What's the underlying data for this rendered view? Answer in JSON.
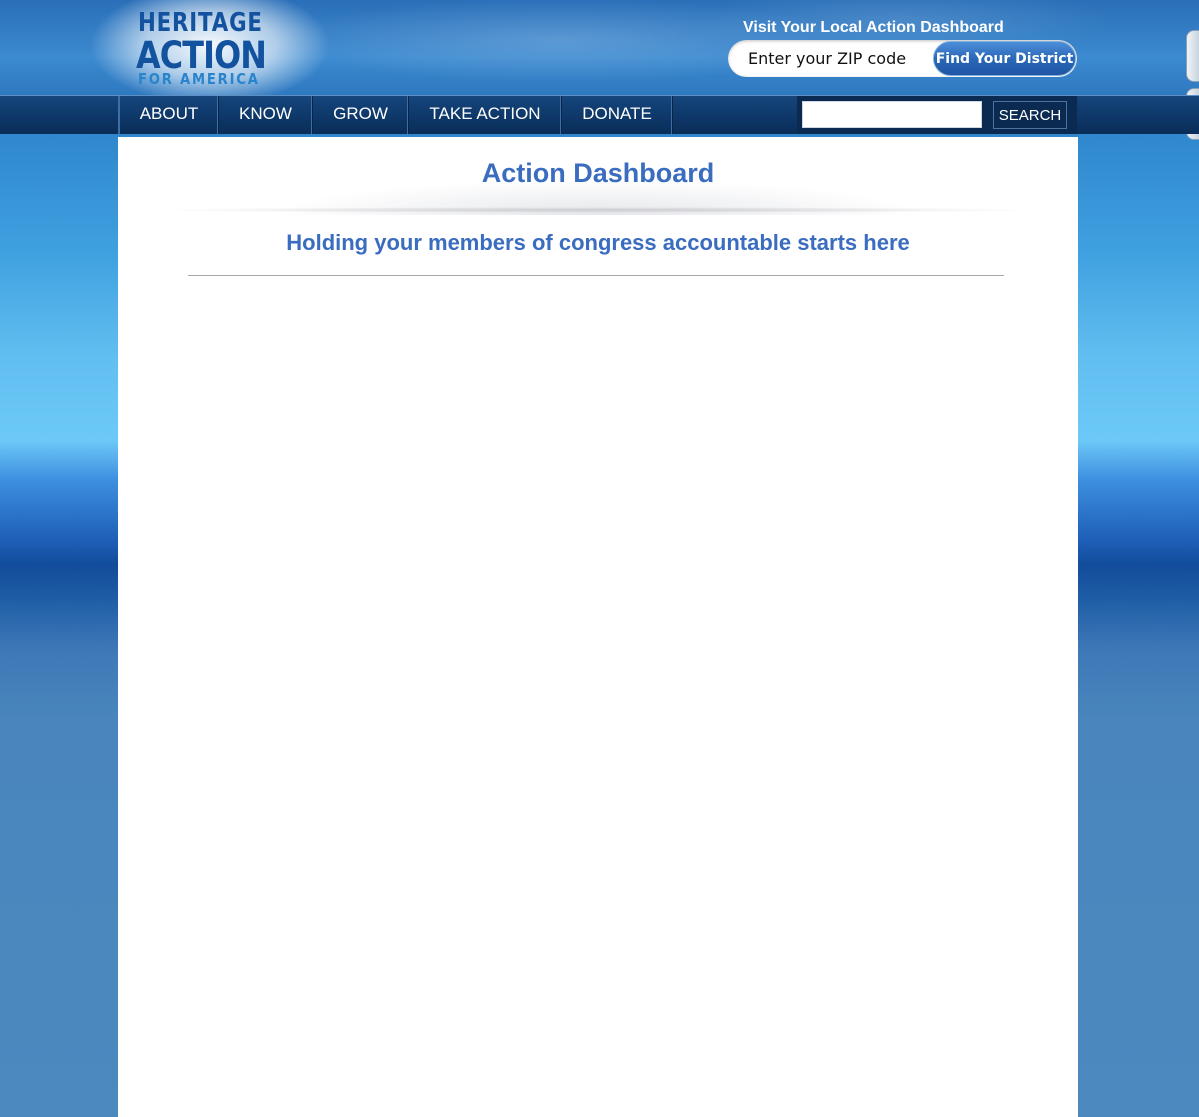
{
  "header": {
    "logo": {
      "line1": "HERITAGE",
      "line2": "ACTION",
      "line3": "FOR AMERICA"
    },
    "visit_title": "Visit Your Local Action Dashboard",
    "zip_placeholder": "Enter your ZIP code",
    "find_button": "Find Your District"
  },
  "nav": {
    "items": [
      {
        "label": "ABOUT"
      },
      {
        "label": "KNOW"
      },
      {
        "label": "GROW"
      },
      {
        "label": "TAKE ACTION"
      },
      {
        "label": "DONATE"
      }
    ],
    "search_value": "",
    "search_button": "SEARCH"
  },
  "main": {
    "title": "Action Dashboard",
    "subtitle": "Holding your members of congress accountable starts here"
  },
  "colors": {
    "accent": "#3a6cbf",
    "nav": "#0f3a6c"
  }
}
